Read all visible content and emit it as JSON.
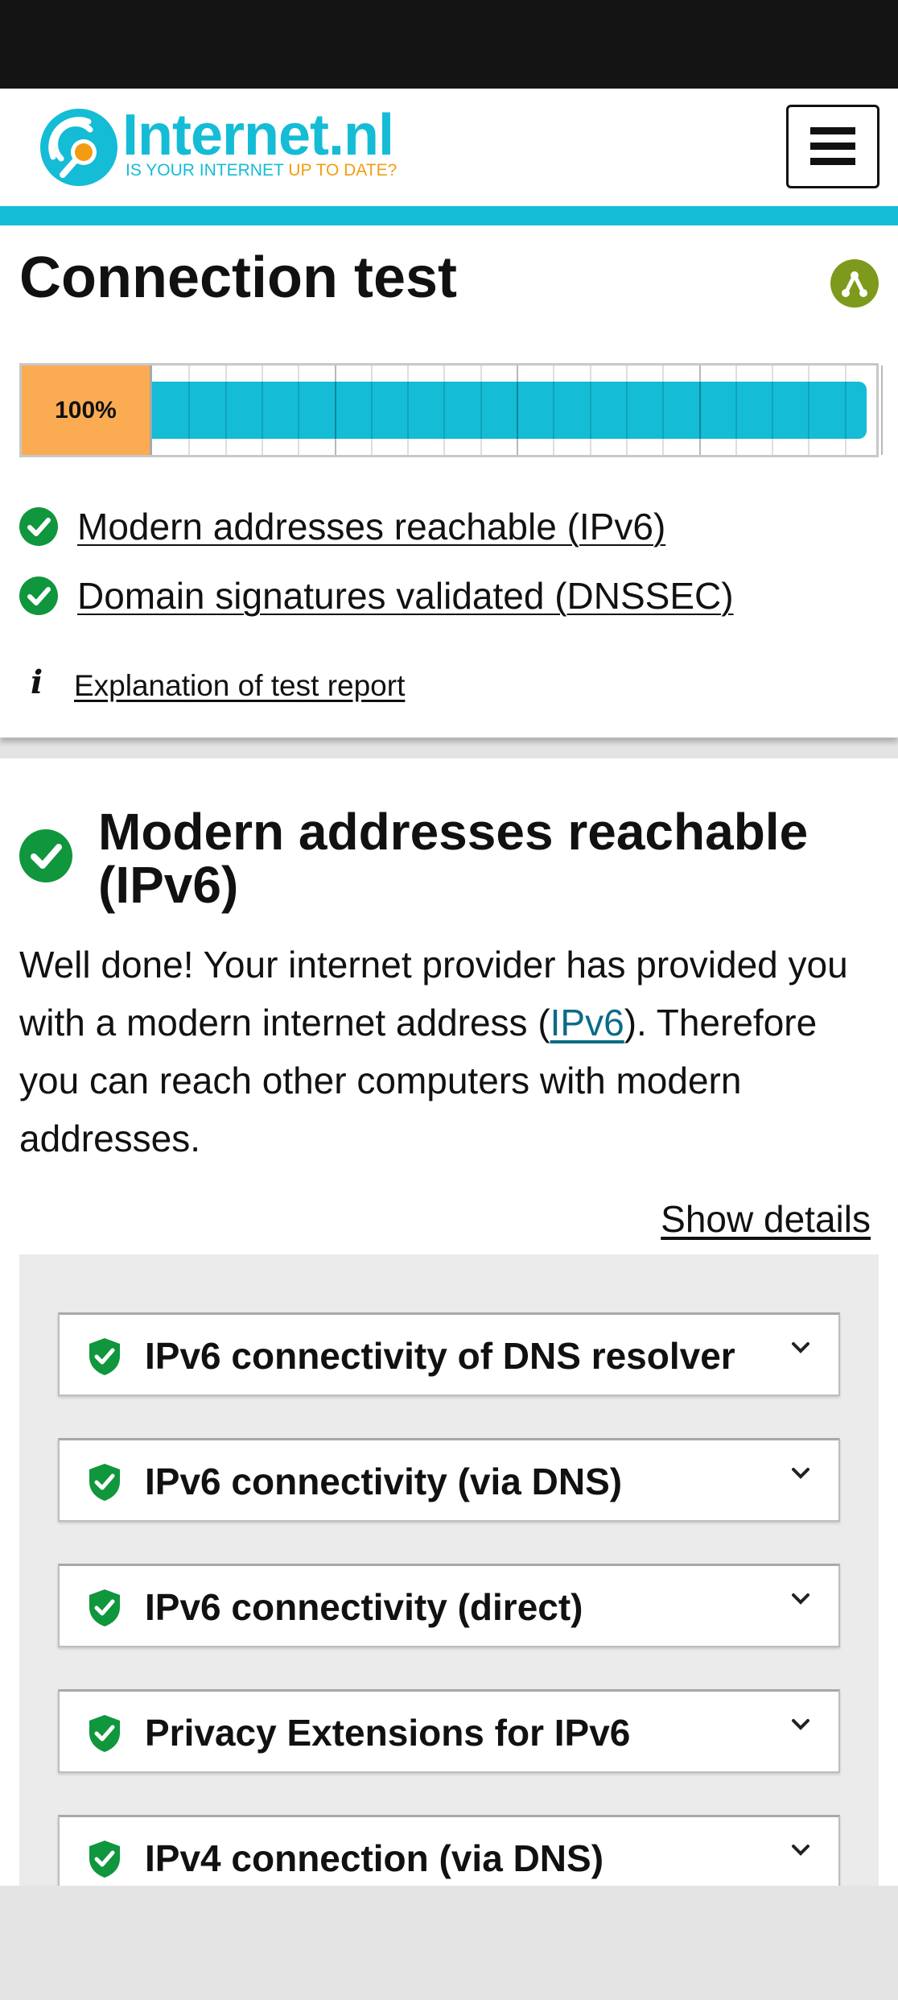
{
  "header": {
    "logo_name": "Internet.nl",
    "logo_tag_part1": "IS YOUR INTERNET",
    "logo_tag_part2": "UP TO DATE?",
    "brand_color": "#14bcd6",
    "accent_color": "#f39c12"
  },
  "result": {
    "title": "Connection test",
    "score_label": "100%",
    "score_value": 100,
    "summary": [
      {
        "label": "Modern addresses reachable (IPv6)",
        "status": "passed"
      },
      {
        "label": "Domain signatures validated (DNSSEC)",
        "status": "passed"
      }
    ],
    "explanation_link": "Explanation of test report"
  },
  "section": {
    "title": "Modern addresses reachable (IPv6)",
    "body_before": "Well done! Your internet provider has provided you with a modern internet address (",
    "body_link": "IPv6",
    "body_after": "). Therefore you can reach other computers with modern addresses.",
    "show_details": "Show details",
    "tests": [
      {
        "label": "IPv6 connectivity of DNS resolver",
        "status": "passed"
      },
      {
        "label": "IPv6 connectivity (via DNS)",
        "status": "passed"
      },
      {
        "label": "IPv6 connectivity (direct)",
        "status": "passed"
      },
      {
        "label": "Privacy Extensions for IPv6",
        "status": "passed"
      },
      {
        "label": "IPv4 connection (via DNS)",
        "status": "passed"
      }
    ]
  },
  "colors": {
    "pass_green": "#10963c",
    "score_orange": "#fbab52",
    "link_blue": "#0b6b87"
  }
}
